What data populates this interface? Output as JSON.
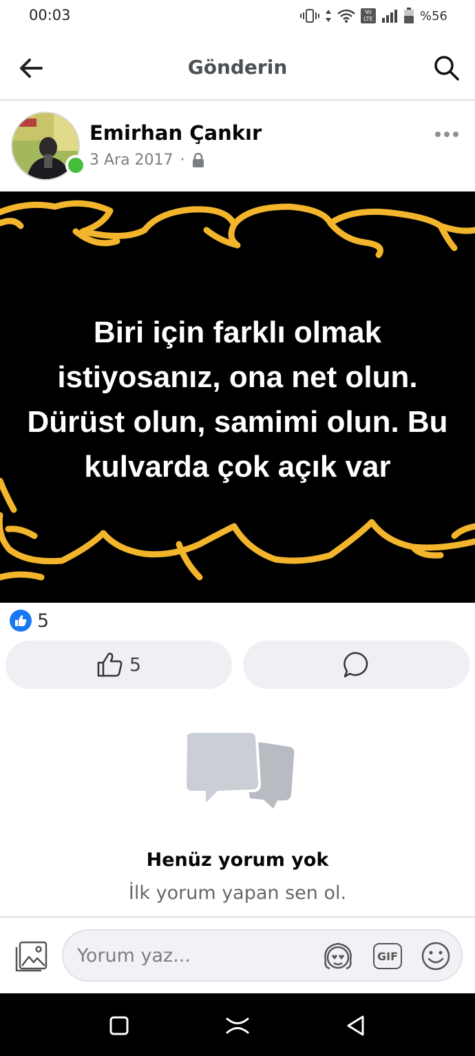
{
  "status_bar": {
    "time": "00:03",
    "network_badge": "Vo LTE",
    "battery": "%56"
  },
  "header": {
    "title": "Gönderin",
    "back_icon": "arrow-left-icon",
    "search_icon": "search-icon"
  },
  "post": {
    "author": "Emirhan Çankır",
    "date": "3 Ara 2017",
    "separator": "·",
    "privacy_icon": "lock-icon",
    "online": true,
    "quote_lines": [
      "Biri için farklı olmak",
      "istiyosanız, ona net olun.",
      "Dürüst olun, samimi olun. Bu",
      "kulvarda çok açık var"
    ],
    "accent_color": "#f2b52c"
  },
  "reactions": {
    "count": "5",
    "like_button_count": "5"
  },
  "empty_state": {
    "title": "Henüz yorum yok",
    "subtitle": "İlk yorum yapan sen ol."
  },
  "composer": {
    "placeholder": "Yorum yaz...",
    "gif_label": "GIF"
  },
  "colors": {
    "brand_blue": "#1877f2",
    "online_green": "#45bd3a",
    "button_bg": "#eff0f3"
  }
}
